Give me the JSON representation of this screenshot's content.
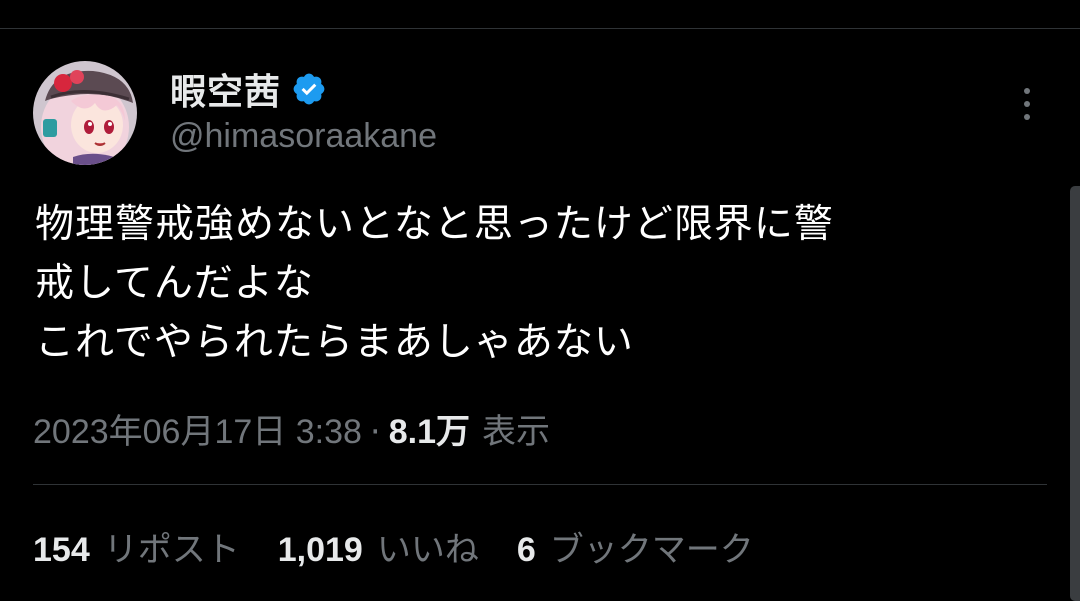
{
  "author": {
    "display_name": "暇空茜",
    "handle": "@himasoraakane",
    "verified": true,
    "avatar_icon": "anime-girl-avatar"
  },
  "tweet": {
    "lines": [
      "物理警戒強めないとなと思ったけど限界に警",
      "戒してんだよな",
      "これでやられたらまあしゃあない"
    ]
  },
  "meta": {
    "timestamp": "2023年06月17日 3:38",
    "separator": "·",
    "views_count": "8.1万",
    "views_label": "表示"
  },
  "stats": [
    {
      "count": "154",
      "label": "リポスト"
    },
    {
      "count": "1,019",
      "label": "いいね"
    },
    {
      "count": "6",
      "label": "ブックマーク"
    }
  ],
  "colors": {
    "background": "#000000",
    "primary_text": "#e7e9ea",
    "secondary_text": "#71767b",
    "verified_blue": "#1d9bf0",
    "divider": "#2f3336"
  }
}
